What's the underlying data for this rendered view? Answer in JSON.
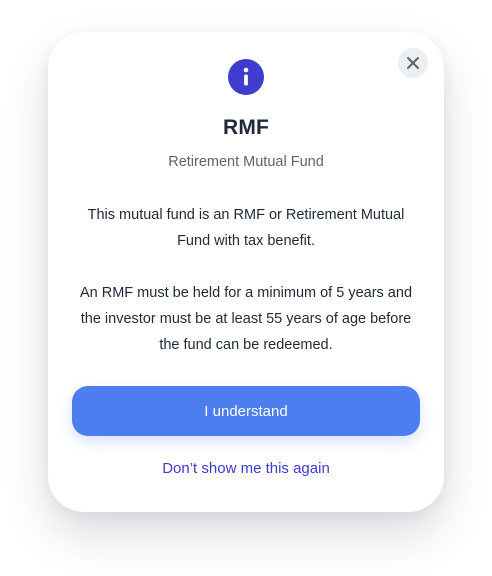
{
  "colors": {
    "accent": "#3f3ccf",
    "primary_button": "#4d7ef0",
    "link": "#3d3ad0",
    "title": "#1f2937",
    "subtitle": "#5b6470",
    "close_bg": "#eceef1"
  },
  "modal": {
    "icon": "info-icon",
    "close_icon": "close-icon",
    "title": "RMF",
    "subtitle": "Retirement Mutual Fund",
    "body": [
      "This mutual fund is an RMF or Retirement Mutual Fund with tax benefit.",
      "An RMF must be held for a minimum of 5 years and the investor must be at least 55 years of age before the fund can be redeemed."
    ],
    "primary_button_label": "I understand",
    "secondary_link_label": "Don’t show me this again"
  }
}
